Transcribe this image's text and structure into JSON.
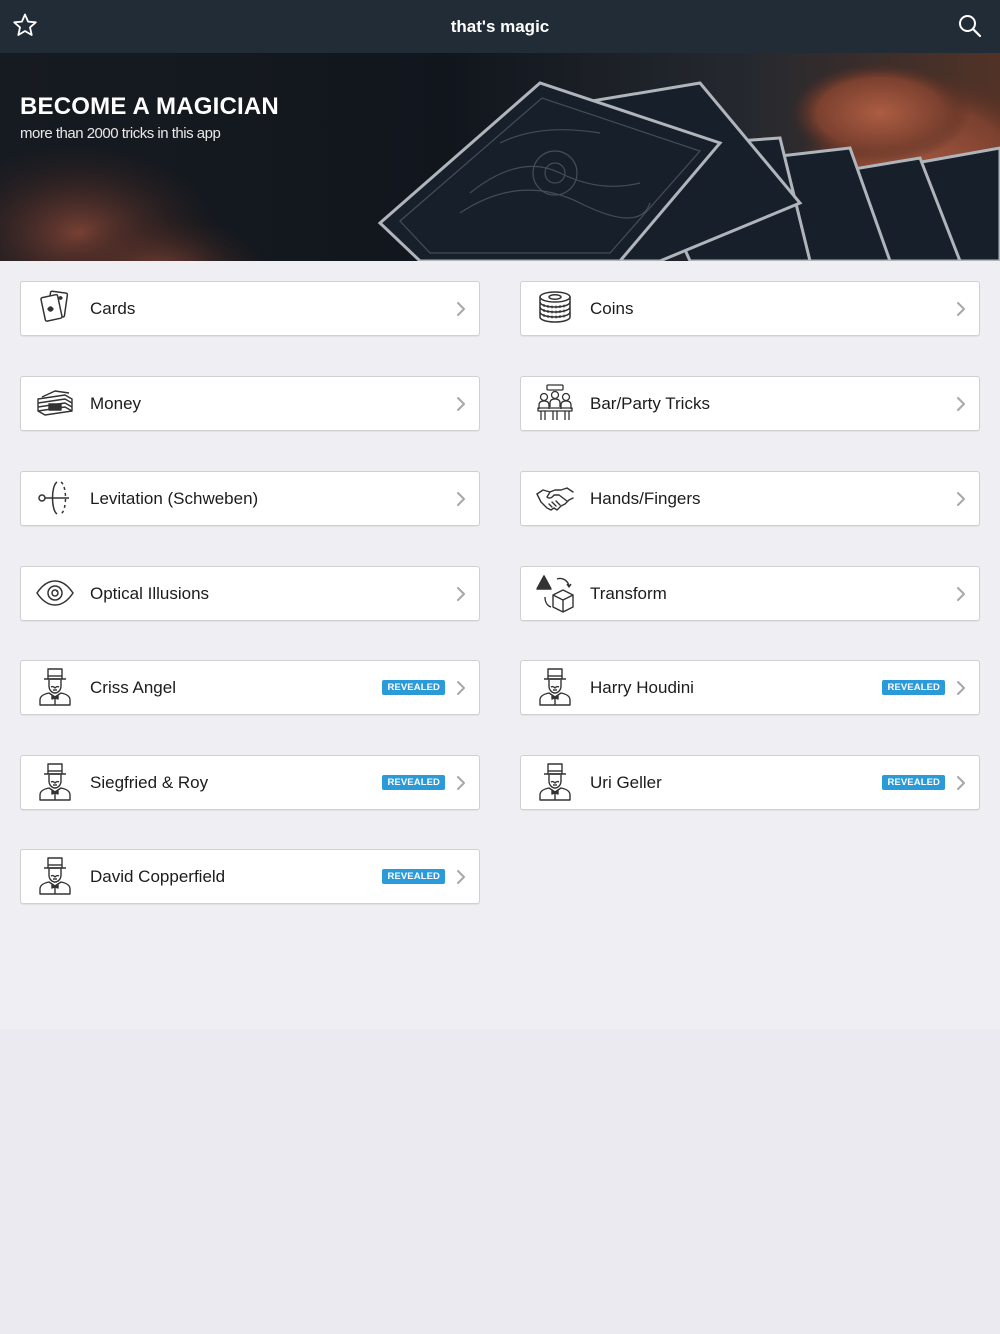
{
  "navbar": {
    "title": "that's magic",
    "favorites_icon": "star-outline-icon",
    "search_icon": "search-icon",
    "background": "#222c36"
  },
  "hero": {
    "title": "BECOME A MAGICIAN",
    "subtitle": "more than 2000 tricks in this app"
  },
  "categories": [
    {
      "label": "Cards",
      "icon": "playing-cards-icon",
      "badge": ""
    },
    {
      "label": "Coins",
      "icon": "coins-stack-icon",
      "badge": ""
    },
    {
      "label": "Money",
      "icon": "banknotes-icon",
      "badge": ""
    },
    {
      "label": "Bar/Party Tricks",
      "icon": "party-people-icon",
      "badge": ""
    },
    {
      "label": "Levitation (Schweben)",
      "icon": "levitation-ring-icon",
      "badge": ""
    },
    {
      "label": "Hands/Fingers",
      "icon": "handshake-icon",
      "badge": ""
    },
    {
      "label": "Optical Illusions",
      "icon": "eye-icon",
      "badge": ""
    },
    {
      "label": "Transform",
      "icon": "shapes-transform-icon",
      "badge": ""
    },
    {
      "label": "Criss Angel",
      "icon": "magician-icon",
      "badge": "REVEALED"
    },
    {
      "label": "Harry Houdini",
      "icon": "magician-icon",
      "badge": "REVEALED"
    },
    {
      "label": "Siegfried & Roy",
      "icon": "magician-icon",
      "badge": "REVEALED"
    },
    {
      "label": "Uri Geller",
      "icon": "magician-icon",
      "badge": "REVEALED"
    },
    {
      "label": "David Copperfield",
      "icon": "magician-icon",
      "badge": "REVEALED"
    }
  ],
  "colors": {
    "badge": "#2b9ad8",
    "page_background": "#edecf1",
    "card_border": "#cfcfd4"
  }
}
